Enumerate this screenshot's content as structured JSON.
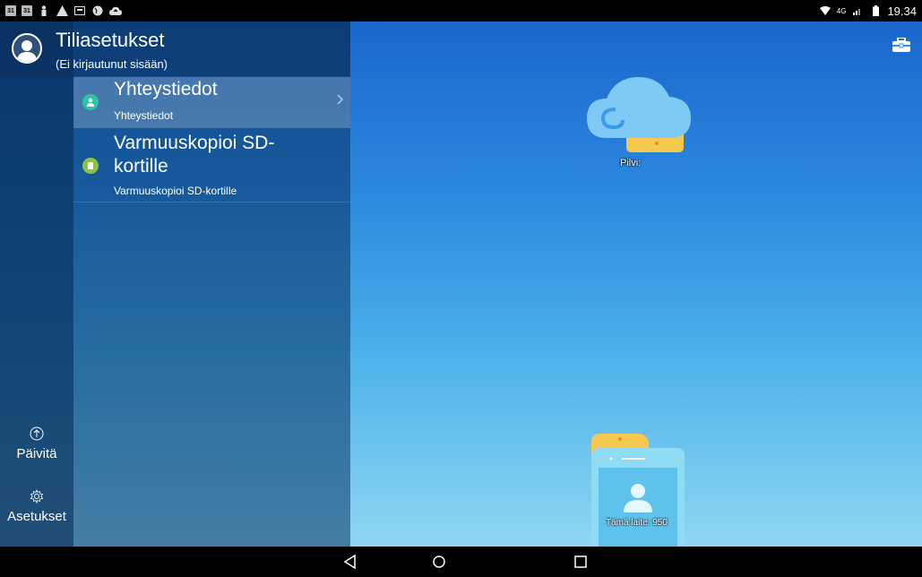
{
  "status_bar": {
    "left_icons": [
      "calendar-icon",
      "calendar-icon",
      "person-icon",
      "warning-icon",
      "screen-icon",
      "globe-icon",
      "cloud-upload-icon"
    ],
    "calendar_day": "31",
    "network": "4G",
    "time": "19.34"
  },
  "account": {
    "title": "Tiliasetukset",
    "subtitle": "(Ei kirjautunut sisään)"
  },
  "menu": {
    "items": [
      {
        "title": "Yhteystiedot",
        "subtitle": "Yhteystiedot",
        "icon_color": "#2ec4a6"
      },
      {
        "title_line1": "Varmuuskopioi SD-",
        "title_line2": "kortille",
        "subtitle": "Varmuuskopioi SD-kortille",
        "icon_color": "#8bc34a"
      }
    ]
  },
  "rail": {
    "refresh_label": "Päivitä",
    "settings_label": "Asetukset"
  },
  "main": {
    "cloud_label": "Pilvi:",
    "device_label": "Tämä laite: 950"
  },
  "colors": {
    "accent_teal": "#2ec4a6",
    "accent_green": "#8bc34a",
    "folder_yellow": "#f5c94e",
    "cloud_blue": "#7fcaf5"
  }
}
